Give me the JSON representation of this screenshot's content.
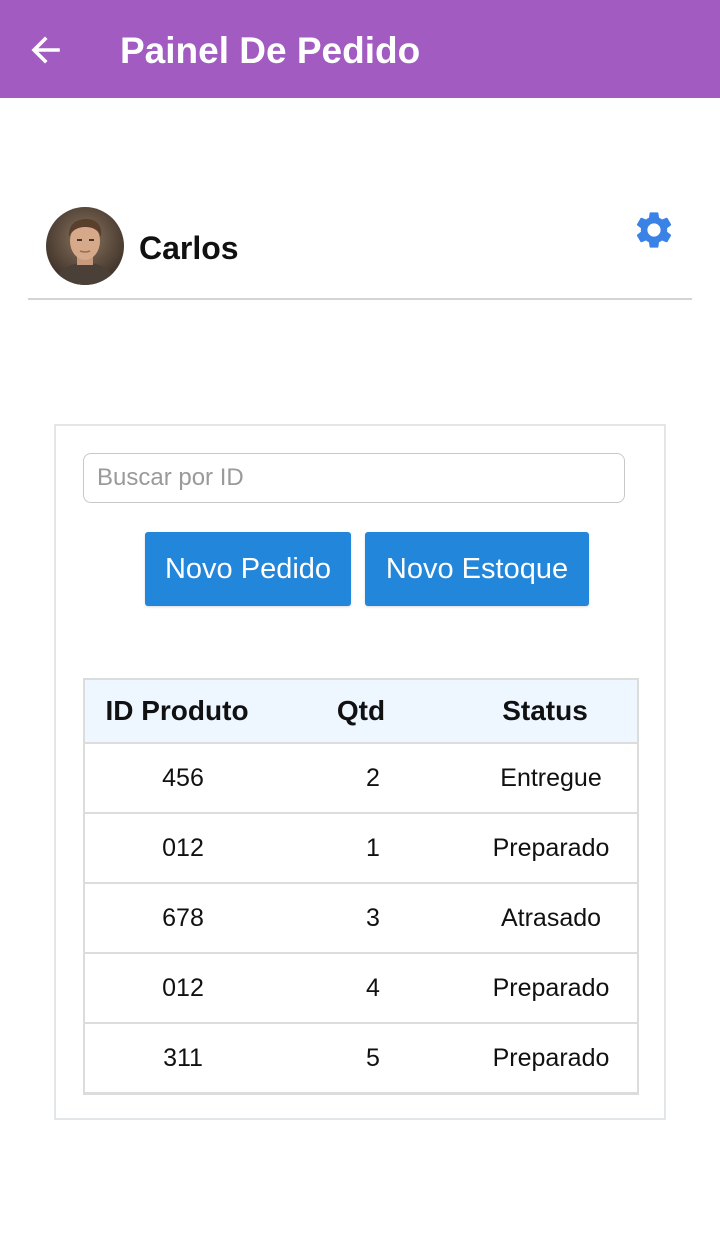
{
  "appbar": {
    "title": "Painel De Pedido",
    "back_icon": "arrow-left-icon",
    "background": "#a25bc0"
  },
  "profile": {
    "name": "Carlos",
    "settings_icon": "gear-icon",
    "settings_color": "#3b82e6"
  },
  "search": {
    "placeholder": "Buscar por ID",
    "value": ""
  },
  "actions": {
    "novo_pedido": "Novo Pedido",
    "novo_estoque": "Novo Estoque",
    "color": "#2286da"
  },
  "table": {
    "columns": [
      "ID Produto",
      "Qtd",
      "Status"
    ],
    "rows": [
      {
        "id": "456",
        "qtd": "2",
        "status": "Entregue"
      },
      {
        "id": "012",
        "qtd": "1",
        "status": "Preparado"
      },
      {
        "id": "678",
        "qtd": "3",
        "status": "Atrasado"
      },
      {
        "id": "012",
        "qtd": "4",
        "status": "Preparado"
      },
      {
        "id": "311",
        "qtd": "5",
        "status": "Preparado"
      }
    ]
  }
}
